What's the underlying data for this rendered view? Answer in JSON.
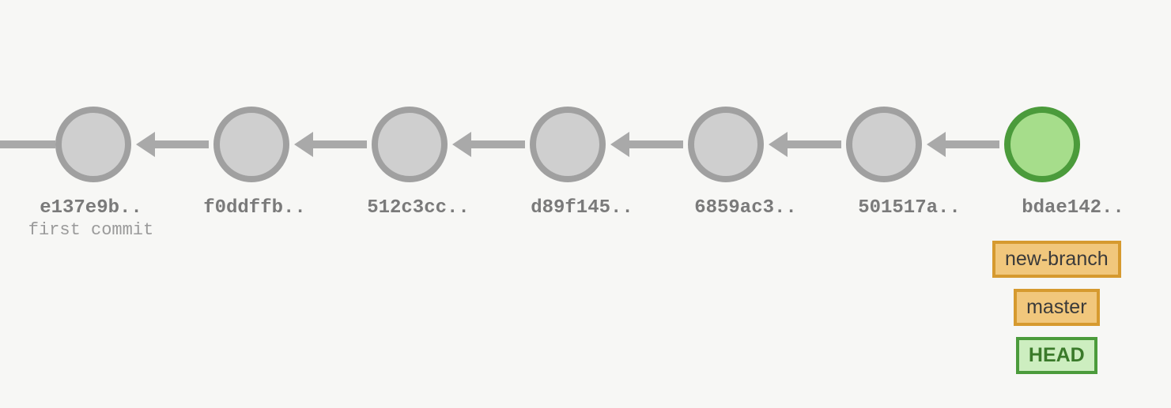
{
  "commits": [
    {
      "hash": "e137e9b..",
      "message": "first commit",
      "isHead": false
    },
    {
      "hash": "f0ddffb..",
      "message": "",
      "isHead": false
    },
    {
      "hash": "512c3cc..",
      "message": "",
      "isHead": false
    },
    {
      "hash": "d89f145..",
      "message": "",
      "isHead": false
    },
    {
      "hash": "6859ac3..",
      "message": "",
      "isHead": false
    },
    {
      "hash": "501517a..",
      "message": "",
      "isHead": false
    },
    {
      "hash": "bdae142..",
      "message": "",
      "isHead": true
    }
  ],
  "refs": {
    "branch1": "new-branch",
    "branch2": "master",
    "head": "HEAD"
  },
  "layout": {
    "commitSpacing": 207,
    "firstX": 115
  }
}
